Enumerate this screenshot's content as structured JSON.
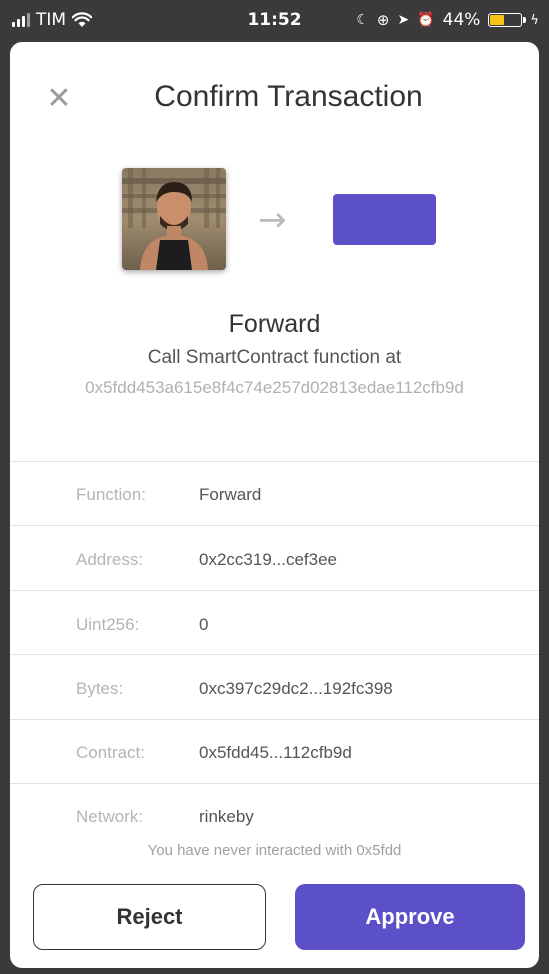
{
  "status_bar": {
    "carrier": "TIM",
    "time": "11:52",
    "battery": "44%",
    "battery_level": 0.44,
    "battery_color": "#f5c518"
  },
  "modal": {
    "title": "Confirm Transaction",
    "close_icon": "close-icon",
    "arrow_icon": "arrow-right-icon",
    "accent_color": "#5b50c8",
    "function_name": "Forward",
    "call_text": "Call SmartContract function at",
    "contract_address": "0x5fdd453a615e8f4c74e257d02813edae112cfb9d",
    "details": [
      {
        "label": "Function:",
        "value": "Forward"
      },
      {
        "label": "Address:",
        "value": "0x2cc319...cef3ee"
      },
      {
        "label": "Uint256:",
        "value": "0"
      },
      {
        "label": "Bytes:",
        "value": "0xc397c29dc2...192fc398"
      },
      {
        "label": "Contract:",
        "value": "0x5fdd45...112cfb9d"
      },
      {
        "label": "Network:",
        "value": "rinkeby"
      }
    ],
    "warning": "You have never interacted with 0x5fdd",
    "reject_label": "Reject",
    "approve_label": "Approve"
  }
}
